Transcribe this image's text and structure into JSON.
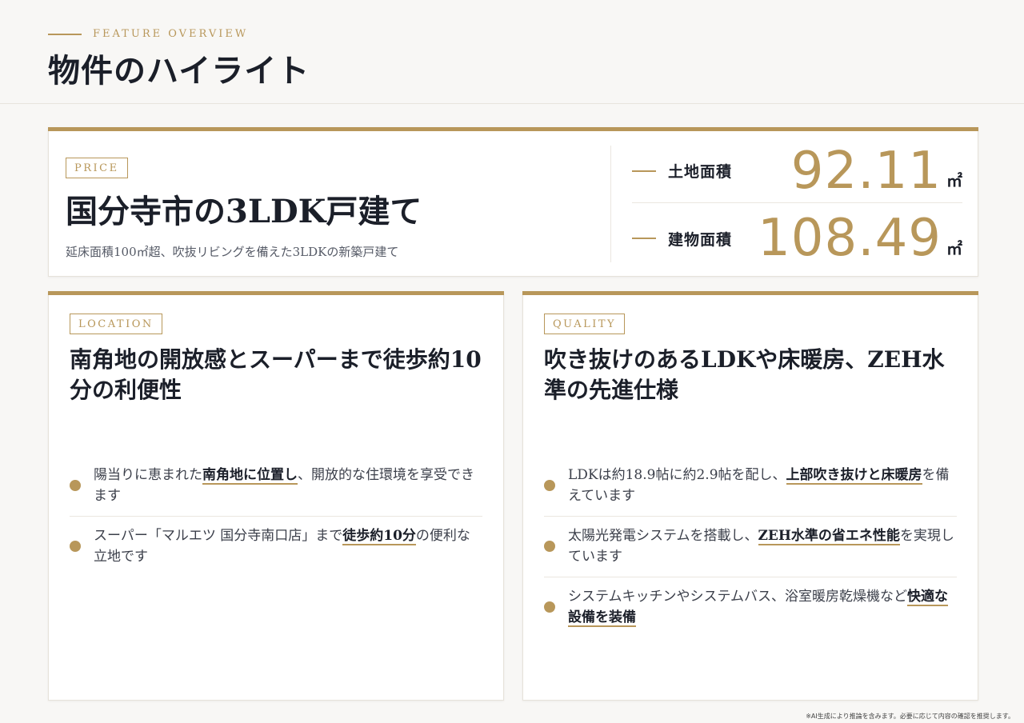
{
  "header": {
    "eyebrow": "FEATURE OVERVIEW",
    "title": "物件のハイライト"
  },
  "price_card": {
    "tag": "PRICE",
    "title": "国分寺市の3LDK戸建て",
    "subtitle": "延床面積100㎡超、吹抜リビングを備えた3LDKの新築戸建て",
    "areas": [
      {
        "label": "土地面積",
        "value": "92.11",
        "unit": "㎡"
      },
      {
        "label": "建物面積",
        "value": "108.49",
        "unit": "㎡"
      }
    ]
  },
  "location_card": {
    "tag": "LOCATION",
    "title": "南角地の開放感とスーパーまで徒歩約10分の利便性",
    "bullets": [
      {
        "before": "陽当りに恵まれた",
        "highlight": "南角地に位置し",
        "after": "、開放的な住環境を享受できます"
      },
      {
        "before": "スーパー「マルエツ 国分寺南口店」まで",
        "highlight": "徒歩約10分",
        "after": "の便利な立地です"
      }
    ]
  },
  "quality_card": {
    "tag": "QUALITY",
    "title": "吹き抜けのあるLDKや床暖房、ZEH水準の先進仕様",
    "bullets": [
      {
        "before": "LDKは約18.9帖に約2.9帖を配し、",
        "highlight": "上部吹き抜けと床暖房",
        "after": "を備えています"
      },
      {
        "before": "太陽光発電システムを搭載し、",
        "highlight": "ZEH水準の省エネ性能",
        "after": "を実現しています"
      },
      {
        "before": "システムキッチンやシステムバス、浴室暖房乾燥機など",
        "highlight": "快適な設備を装備",
        "after": ""
      }
    ]
  },
  "footnote": "※AI生成により推論を含みます。必要に応じて内容の確認を推奨します。",
  "colors": {
    "accent": "#b8975a",
    "text": "#1b1f29",
    "background": "#f8f7f5"
  }
}
